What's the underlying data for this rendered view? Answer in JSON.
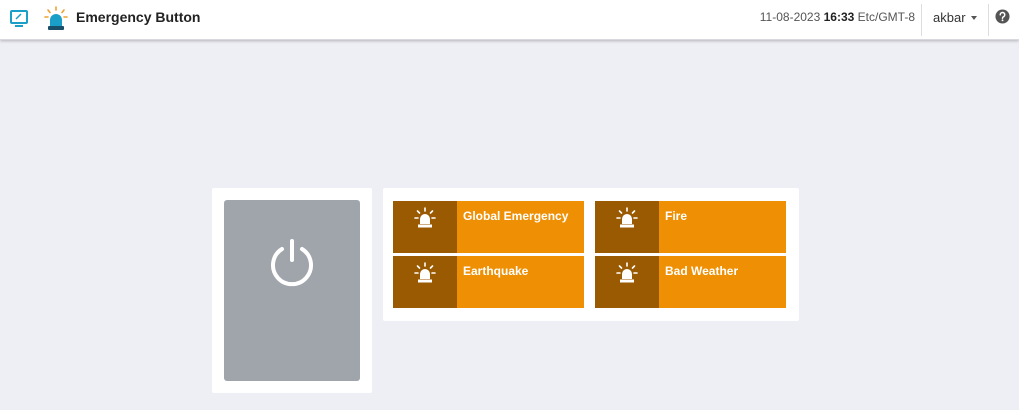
{
  "header": {
    "title": "Emergency Button",
    "date": "11-08-2023",
    "time": "16:33",
    "timezone": "Etc/GMT-8",
    "user": "akbar",
    "icons": [
      "monitor-icon",
      "siren-icon",
      "caret-down-icon",
      "help-icon"
    ]
  },
  "power": {
    "icon": "power-icon",
    "color": "#a0a5ab"
  },
  "emergencies": [
    {
      "label": "Global Emergency",
      "icon": "siren-icon"
    },
    {
      "label": "Fire",
      "icon": "siren-icon"
    },
    {
      "label": "Earthquake",
      "icon": "siren-icon"
    },
    {
      "label": "Bad Weather",
      "icon": "siren-icon"
    }
  ],
  "colors": {
    "tile": "#ee8f04",
    "tile_icon_bg": "#995a02",
    "background": "#eeeef5",
    "accent": "#1a9fc9"
  }
}
